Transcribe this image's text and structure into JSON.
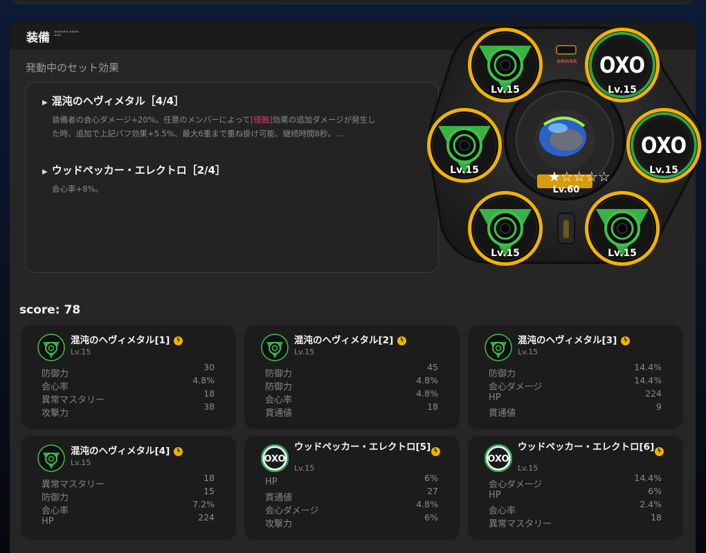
{
  "panel": {
    "title": "装備",
    "set_effects_label": "発動中のセット効果"
  },
  "set_effects": [
    {
      "title": "混沌のヘヴィメタル［4/4］",
      "desc_pre": "装備者の会心ダメージ+20%。任意のメンバーによって",
      "desc_kw": "[侵蝕]",
      "desc_post": "効果の追加ダメージが発生した時、追加で上記バフ効果+5.5%、最大6重まで重ね掛け可能、継続時間8秒。..."
    },
    {
      "title": "ウッドペッカー・エレクトロ［2/4］",
      "desc": "会心率+8%。"
    }
  ],
  "score": "score: 78",
  "engine": {
    "level": "Lv.60",
    "stars": "★☆☆☆☆",
    "driver_label": "DRIVER"
  },
  "disks": [
    {
      "slot": 1,
      "type": "chaos",
      "level": "Lv.15"
    },
    {
      "slot": 2,
      "type": "oxo",
      "level": "Lv.15"
    },
    {
      "slot": 3,
      "type": "oxo",
      "level": "Lv.15"
    },
    {
      "slot": 4,
      "type": "chaos",
      "level": "Lv.15"
    },
    {
      "slot": 5,
      "type": "chaos",
      "level": "Lv.15"
    },
    {
      "slot": 6,
      "type": "chaos",
      "level": "Lv.15"
    }
  ],
  "cards": [
    {
      "name": "混沌のヘヴィメタル[1]",
      "level": "Lv.15",
      "icon": "chaos",
      "stats": [
        [
          "防御力",
          "30"
        ],
        [
          "会心率",
          "4.8%"
        ],
        [
          "異常マスタリー",
          "18"
        ],
        [
          "攻撃力",
          "38"
        ]
      ]
    },
    {
      "name": "混沌のヘヴィメタル[2]",
      "level": "Lv.15",
      "icon": "chaos",
      "stats": [
        [
          "防御力",
          "45"
        ],
        [
          "防御力",
          "4.8%"
        ],
        [
          "会心率",
          "4.8%"
        ],
        [
          "貫通値",
          "18"
        ]
      ]
    },
    {
      "name": "混沌のヘヴィメタル[3]",
      "level": "Lv.15",
      "icon": "chaos",
      "stats": [
        [
          "防御力",
          "14.4%"
        ],
        [
          "会心ダメージ",
          "14.4%"
        ],
        [
          "HP",
          "224"
        ],
        [
          "貫通値",
          "9"
        ]
      ]
    },
    {
      "name": "混沌のヘヴィメタル[4]",
      "level": "Lv.15",
      "icon": "chaos",
      "stats": [
        [
          "異常マスタリー",
          "18"
        ],
        [
          "防御力",
          "15"
        ],
        [
          "会心率",
          "7.2%"
        ],
        [
          "HP",
          "224"
        ]
      ]
    },
    {
      "name": "ウッドペッカー・エレクトロ[5]",
      "level": "Lv.15",
      "icon": "oxo",
      "stats": [
        [
          "HP",
          "6%"
        ],
        [
          "貫通値",
          "27"
        ],
        [
          "会心ダメージ",
          "4.8%"
        ],
        [
          "攻撃力",
          "6%"
        ]
      ]
    },
    {
      "name": "ウッドペッカー・エレクトロ[6]",
      "level": "Lv.15",
      "icon": "oxo",
      "stats": [
        [
          "会心ダメージ",
          "14.4%"
        ],
        [
          "HP",
          "6%"
        ],
        [
          "会心率",
          "2.4%"
        ],
        [
          "異常マスタリー",
          "18"
        ]
      ]
    }
  ],
  "colors": {
    "chaos_green": "#3ec24a",
    "oxo_green": "#2aa64f",
    "gold_ring": "#f2b200",
    "panel_bg": "#262626",
    "card_bg": "#1c1c1c",
    "keyword": "#e0406c"
  }
}
